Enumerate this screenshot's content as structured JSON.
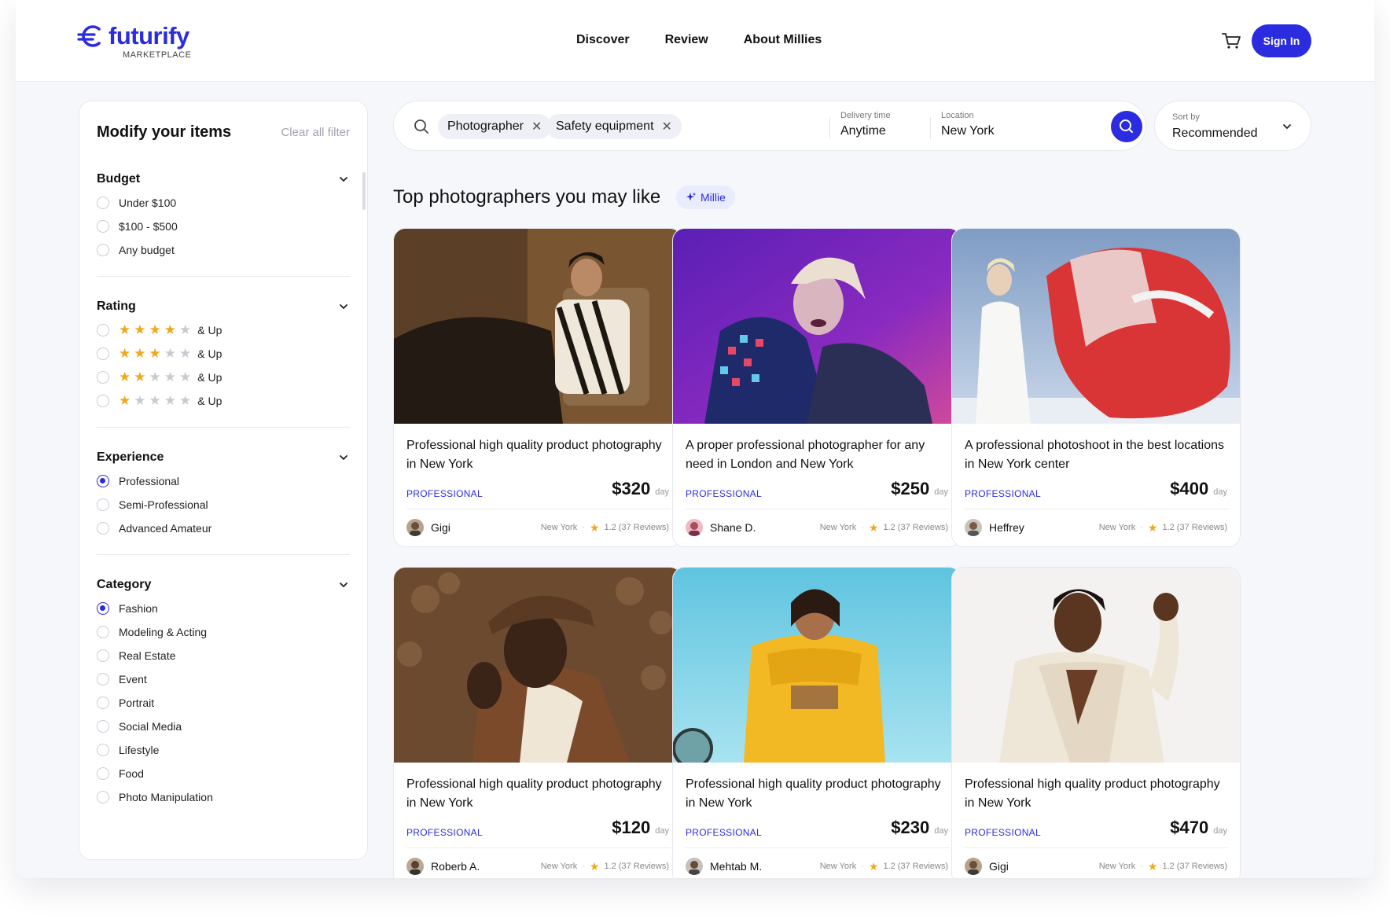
{
  "brand": {
    "name": "futurify",
    "sub": "MARKETPLACE",
    "color": "#2b2be0"
  },
  "nav": [
    "Discover",
    "Review",
    "About Millies"
  ],
  "header": {
    "sign_in": "Sign In"
  },
  "sidebar": {
    "title": "Modify your items",
    "clear": "Clear all filter",
    "budget": {
      "title": "Budget",
      "options": [
        "Under $100",
        "$100 - $500",
        "Any budget"
      ]
    },
    "rating": {
      "title": "Rating",
      "suffix": "& Up",
      "levels": [
        4,
        3,
        2,
        1
      ]
    },
    "experience": {
      "title": "Experience",
      "options": [
        "Professional",
        "Semi-Professional",
        "Advanced Amateur"
      ],
      "selected": 0
    },
    "category": {
      "title": "Category",
      "options": [
        "Fashion",
        "Modeling & Acting",
        "Real Estate",
        "Event",
        "Portrait",
        "Social Media",
        "Lifestyle",
        "Food",
        "Photo Manipulation"
      ],
      "selected": 0
    }
  },
  "search": {
    "chips": [
      "Photographer",
      "Safety equipment"
    ],
    "delivery": {
      "label": "Delivery time",
      "value": "Anytime"
    },
    "location": {
      "label": "Location",
      "value": "New York"
    }
  },
  "sort": {
    "label": "Sort by",
    "value": "Recommended"
  },
  "heading": "Top photographers you may like",
  "millie_badge": "Millie",
  "cards": [
    {
      "title": "Professional high quality product photography in New York",
      "level": "PROFESSIONAL",
      "price": "$320",
      "per": "day",
      "author": "Gigi",
      "location": "New York",
      "rating": "1.2 (37 Reviews)"
    },
    {
      "title": "A proper professional photographer for any need in London and New York",
      "level": "PROFESSIONAL",
      "price": "$250",
      "per": "day",
      "author": "Shane D.",
      "location": "New York",
      "rating": "1.2 (37 Reviews)"
    },
    {
      "title": "A professional photoshoot in the best locations in New York center",
      "level": "PROFESSIONAL",
      "price": "$400",
      "per": "day",
      "author": "Heffrey",
      "location": "New York",
      "rating": "1.2 (37 Reviews)"
    },
    {
      "title": "Professional high quality product photography in New York",
      "level": "PROFESSIONAL",
      "price": "$120",
      "per": "day",
      "author": "Roberb A.",
      "location": "New York",
      "rating": "1.2 (37 Reviews)"
    },
    {
      "title": "Professional high quality product photography in New York",
      "level": "PROFESSIONAL",
      "price": "$230",
      "per": "day",
      "author": "Mehtab M.",
      "location": "New York",
      "rating": "1.2 (37 Reviews)"
    },
    {
      "title": "Professional high quality product photography in New York",
      "level": "PROFESSIONAL",
      "price": "$470",
      "per": "day",
      "author": "Gigi",
      "location": "New York",
      "rating": "1.2 (37 Reviews)"
    }
  ]
}
